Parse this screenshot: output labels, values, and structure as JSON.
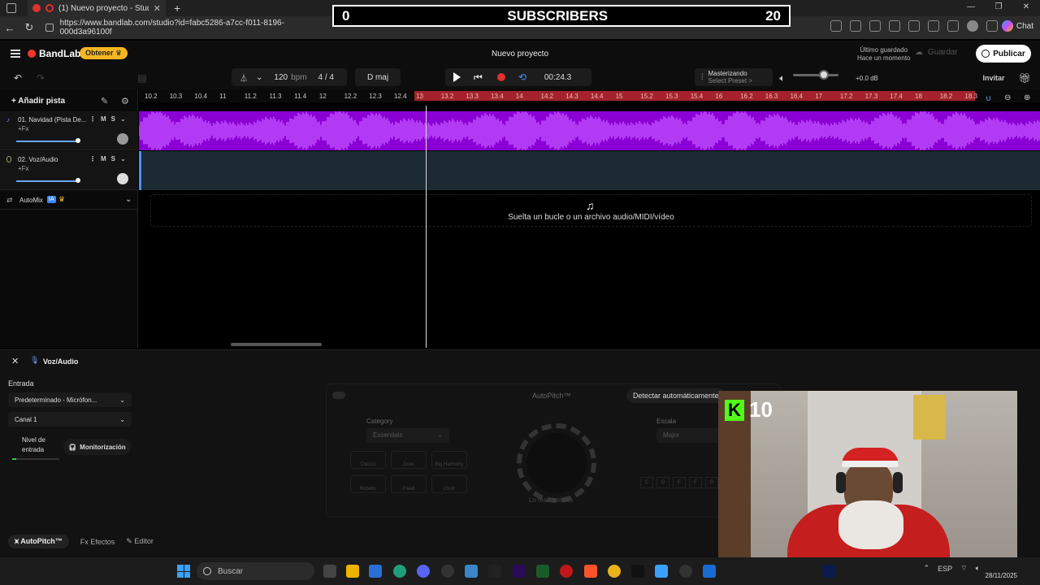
{
  "browser": {
    "tab_title": "(1) Nuevo proyecto - Studio",
    "url": "https://www.bandlab.com/studio?id=fabc5286-a7cc-f011-8196-000d3a96100f",
    "chat_label": "Chat"
  },
  "overlay": {
    "subs_left": "0",
    "subs_label": "SUBSCRIBERS",
    "subs_right": "20",
    "kick_count": "10"
  },
  "header": {
    "logo": "BandLab",
    "obtener": "Obtener",
    "project_title": "Nuevo proyecto",
    "saved_line1": "Último guardado",
    "saved_line2": "Hace un momento",
    "guardar": "Guardar",
    "publicar": "Publicar"
  },
  "transport": {
    "bpm_value": "120",
    "bpm_unit": "bpm",
    "time_sig": "4 / 4",
    "key": "D maj",
    "time": "00:24.3",
    "mastering": "Masterizando",
    "preset": "Select Preset >",
    "db": "+0.0 dB",
    "invitar": "Invitar"
  },
  "tracks": {
    "add_track": "Añadir pista",
    "t1_name": "01. Navidad (Pista De...",
    "t1_fx": "+Fx",
    "t2_name": "02. Voz/Audio",
    "t2_fx": "+Fx",
    "m": "M",
    "s": "S",
    "automix": "AutoMix",
    "ia": "IA",
    "drop_text": "Suelta un bucle o un archivo audio/MIDI/vídeo"
  },
  "ruler": {
    "ticks_white": [
      "10.2",
      "10.3",
      "10.4",
      "11",
      "11.2",
      "11.3",
      "11.4",
      "12",
      "12.2",
      "12.3",
      "12.4"
    ],
    "ticks_red": [
      "13",
      "13.2",
      "13.3",
      "13.4",
      "14",
      "14.2",
      "14.3",
      "14.4",
      "15",
      "15.2",
      "15.3",
      "15.4",
      "16",
      "16.2",
      "16.3",
      "16.4",
      "17",
      "17.2",
      "17.3",
      "17.4",
      "18",
      "18.2",
      "18.3"
    ]
  },
  "bottom": {
    "title": "Voz/Audio",
    "entrada": "Entrada",
    "input_device": "Predeterminado - Micrófon...",
    "canal": "Canal 1",
    "nivel1": "Nivel de",
    "nivel2": "entrada",
    "monitorizacion": "Monitorización",
    "autopitch": "AutoPitch™",
    "detectar": "Detectar automáticamente",
    "category": "Category",
    "category_value": "Essentials",
    "escala": "Escala",
    "escala_value": "Major",
    "presets": [
      "Classic",
      "Duet",
      "Big Harmony",
      "Robotic",
      "Fixed",
      "Choir"
    ],
    "dial_label": "Lo más intenso",
    "keys": [
      "C",
      "D",
      "E",
      "F",
      "G"
    ],
    "tab_autopitch": "AutoPitch™",
    "tab_efectos": "Efectos",
    "tab_editor": "Editor"
  },
  "taskbar": {
    "search": "Buscar",
    "lang": "ESP",
    "date": "28/11/2025"
  }
}
